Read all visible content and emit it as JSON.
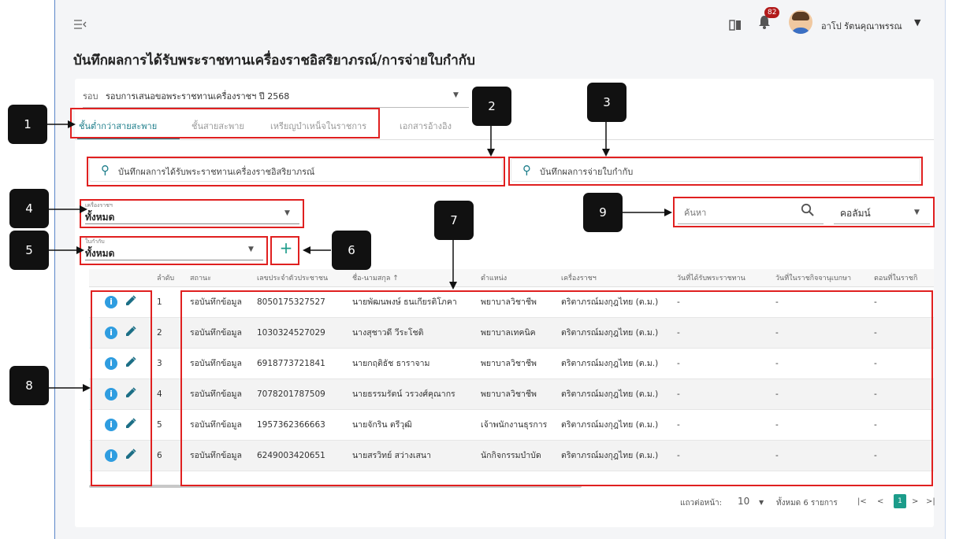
{
  "topbar": {
    "notification_count": "82",
    "user_name": "อาโป รัตนคุณาพรรณ",
    "icons": [
      "menu-collapse-icon",
      "book-icon",
      "bell-icon",
      "avatar",
      "chevron-down-icon"
    ]
  },
  "page": {
    "title": "บันทึกผลการได้รับพระราชทานเครื่องราชอิสริยาภรณ์/การจ่ายใบกำกับ"
  },
  "round": {
    "label": "รอบ",
    "value": "รอบการเสนอขอพระราชทานเครื่องราชฯ ปี 2568"
  },
  "tabs": [
    {
      "label": "ชั้นต่ำกว่าสายสะพาย",
      "active": true
    },
    {
      "label": "ชั้นสายสะพาย",
      "active": false
    },
    {
      "label": "เหรียญบำเหน็จในราชการ",
      "active": false
    },
    {
      "label": "เอกสารอ้างอิง",
      "active": false
    }
  ],
  "actions": {
    "record_award": "บันทึกผลการได้รับพระราชทานเครื่องราชอิสริยาภรณ์",
    "record_certificate": "บันทึกผลการจ่ายใบกำกับ"
  },
  "filters": {
    "decoration": {
      "label": "เครื่องราชฯ",
      "value": "ทั้งหมด"
    },
    "certificate": {
      "label": "ใบกำกับ",
      "value": "ทั้งหมด"
    }
  },
  "search": {
    "placeholder": "ค้นหา",
    "column_select": "คอลัมน์"
  },
  "table": {
    "headers": [
      "",
      "ลำดับ",
      "สถานะ",
      "เลขประจำตัวประชาชน",
      "ชื่อ-นามสกุล ↑",
      "ตำแหน่ง",
      "เครื่องราชฯ",
      "วันที่ได้รับพระราชทาน",
      "วันที่ในราชกิจจานุเบกษา",
      "ตอนที่ในราชกิ"
    ],
    "rows": [
      [
        "1",
        "รอบันทึกข้อมูล",
        "8050175327527",
        "นายพัฒนพงษ์ ธนเกียรติโภคา",
        "พยาบาลวิชาชีพ",
        "ตริตาภรณ์มงกุฎไทย (ต.ม.)",
        "-",
        "-",
        "-"
      ],
      [
        "2",
        "รอบันทึกข้อมูล",
        "1030324527029",
        "นางสุชาวดี วีระโชติ",
        "พยาบาลเทคนิค",
        "ตริตาภรณ์มงกุฎไทย (ต.ม.)",
        "-",
        "-",
        "-"
      ],
      [
        "3",
        "รอบันทึกข้อมูล",
        "6918773721841",
        "นายกฤติธัช ธาราจาม",
        "พยาบาลวิชาชีพ",
        "ตริตาภรณ์มงกุฎไทย (ต.ม.)",
        "-",
        "-",
        "-"
      ],
      [
        "4",
        "รอบันทึกข้อมูล",
        "7078201787509",
        "นายธรรมรัตน์ วรวงศ์คุณากร",
        "พยาบาลวิชาชีพ",
        "ตริตาภรณ์มงกุฎไทย (ต.ม.)",
        "-",
        "-",
        "-"
      ],
      [
        "5",
        "รอบันทึกข้อมูล",
        "1957362366663",
        "นายจักริน ตรีวุฒิ",
        "เจ้าพนักงานธุรการ",
        "ตริตาภรณ์มงกุฎไทย (ต.ม.)",
        "-",
        "-",
        "-"
      ],
      [
        "6",
        "รอบันทึกข้อมูล",
        "6249003420651",
        "นายสรวิทย์ สว่างเสนา",
        "นักกิจกรรมบำบัด",
        "ตริตาภรณ์มงกุฎไทย (ต.ม.)",
        "-",
        "-",
        "-"
      ]
    ]
  },
  "pagination": {
    "rows_per_page_label": "แถวต่อหน้า:",
    "rows_per_page": "10",
    "total": "ทั้งหมด 6 รายการ",
    "first": "|<",
    "prev": "<",
    "current": "1",
    "next": ">",
    "last": ">|"
  },
  "callouts": [
    "1",
    "2",
    "3",
    "4",
    "5",
    "6",
    "7",
    "8",
    "9"
  ],
  "colors": {
    "accent": "#1c7d8a",
    "annotation_red": "#e02020",
    "info_blue": "#2f9de0"
  }
}
